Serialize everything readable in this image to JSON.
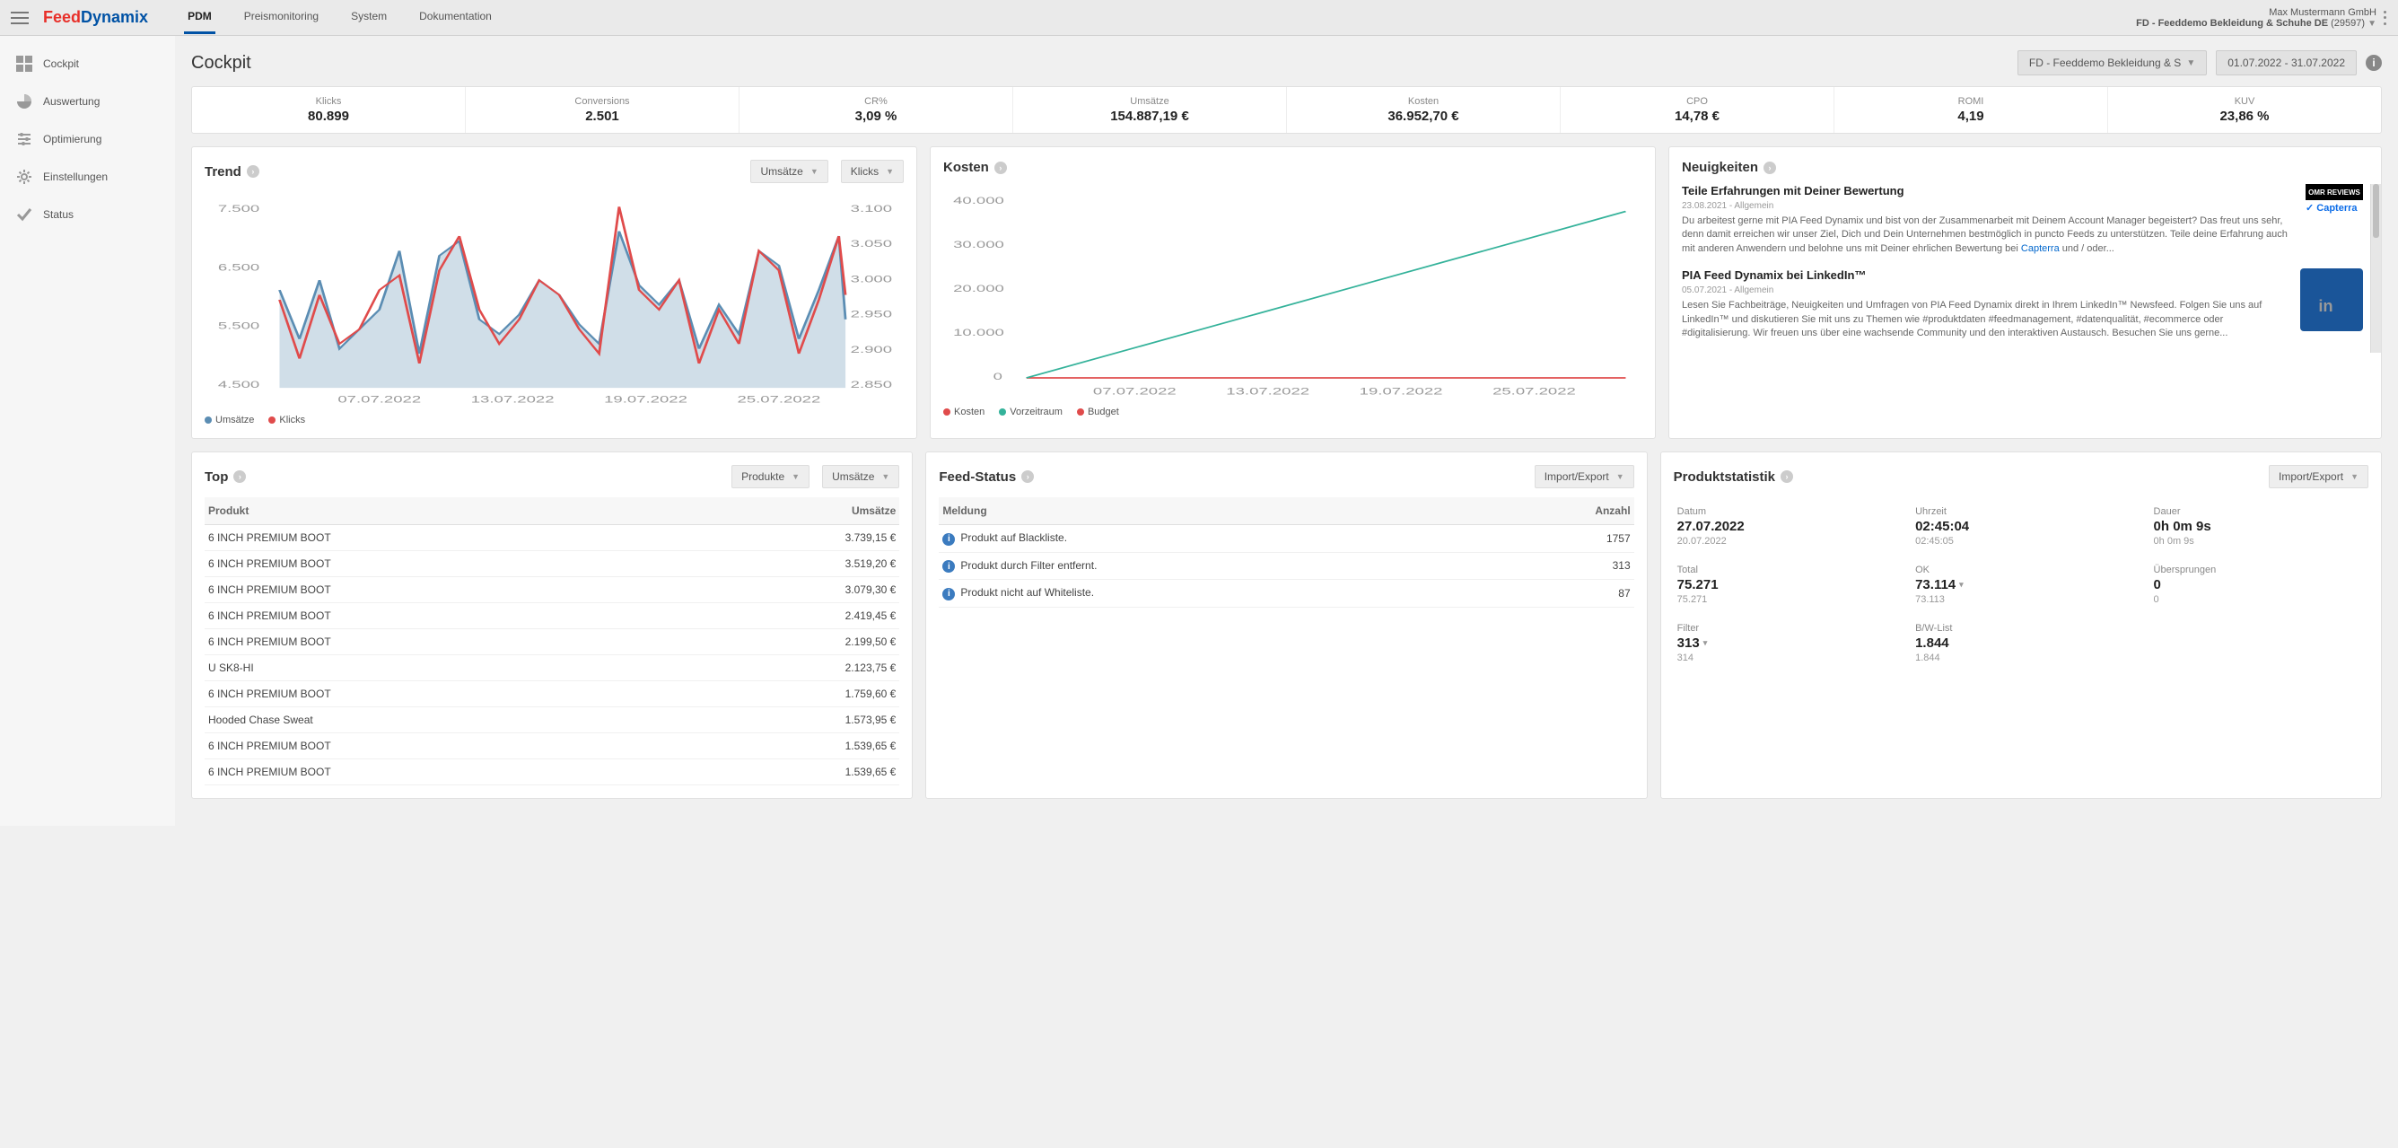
{
  "header": {
    "logo_part1": "Feed",
    "logo_part2": "Dynamix",
    "nav": [
      "PDM",
      "Preismonitoring",
      "System",
      "Dokumentation"
    ],
    "company": "Max Mustermann GmbH",
    "account": "FD - Feeddemo Bekleidung & Schuhe DE",
    "account_id": "(29597)"
  },
  "sidebar": {
    "items": [
      {
        "label": "Cockpit",
        "icon": "dashboard"
      },
      {
        "label": "Auswertung",
        "icon": "pie"
      },
      {
        "label": "Optimierung",
        "icon": "sliders"
      },
      {
        "label": "Einstellungen",
        "icon": "gear"
      },
      {
        "label": "Status",
        "icon": "check"
      }
    ]
  },
  "page": {
    "title": "Cockpit",
    "account_select": "FD - Feeddemo Bekleidung & S",
    "daterange": "01.07.2022 - 31.07.2022"
  },
  "kpis": [
    {
      "label": "Klicks",
      "value": "80.899"
    },
    {
      "label": "Conversions",
      "value": "2.501"
    },
    {
      "label": "CR%",
      "value": "3,09 %"
    },
    {
      "label": "Umsätze",
      "value": "154.887,19 €"
    },
    {
      "label": "Kosten",
      "value": "36.952,70 €"
    },
    {
      "label": "CPO",
      "value": "14,78 €"
    },
    {
      "label": "ROMI",
      "value": "4,19"
    },
    {
      "label": "KUV",
      "value": "23,86 %"
    }
  ],
  "trend": {
    "title": "Trend",
    "dd1": "Umsätze",
    "dd2": "Klicks",
    "legend": {
      "a": "Umsätze",
      "b": "Klicks"
    }
  },
  "kosten": {
    "title": "Kosten",
    "legend": {
      "a": "Kosten",
      "b": "Vorzeitraum",
      "c": "Budget"
    }
  },
  "news": {
    "title": "Neuigkeiten",
    "items": [
      {
        "title": "Teile Erfahrungen mit Deiner Bewertung",
        "meta": "23.08.2021 - Allgemein",
        "body": "Du arbeitest gerne mit PIA Feed Dynamix und bist von der Zusammenarbeit mit Deinem Account Manager begeistert? Das freut uns sehr, denn damit erreichen wir unser Ziel, Dich und Dein Unternehmen bestmöglich in puncto Feeds zu unterstützen. Teile deine Erfahrung auch mit anderen Anwendern und belohne uns mit Deiner ehrlichen Bewertung bei ",
        "link": "Capterra",
        "tail": " und / oder..."
      },
      {
        "title": "PIA Feed Dynamix bei LinkedIn™",
        "meta": "05.07.2021 - Allgemein",
        "body": "Lesen Sie Fachbeiträge, Neuigkeiten und Umfragen von PIA Feed Dynamix direkt in Ihrem LinkedIn™ Newsfeed. Folgen Sie uns auf LinkedIn™ und diskutieren Sie mit uns zu Themen wie #produktdaten #feedmanagement, #datenqualität, #ecommerce oder #digitalisierung. Wir freuen uns über eine wachsende Community und den interaktiven Austausch. Besuchen Sie uns gerne..."
      }
    ]
  },
  "top": {
    "title": "Top",
    "dd1": "Produkte",
    "dd2": "Umsätze",
    "col1": "Produkt",
    "col2": "Umsätze",
    "rows": [
      {
        "p": "6 INCH PREMIUM BOOT",
        "v": "3.739,15 €"
      },
      {
        "p": "6 INCH PREMIUM BOOT",
        "v": "3.519,20 €"
      },
      {
        "p": "6 INCH PREMIUM BOOT",
        "v": "3.079,30 €"
      },
      {
        "p": "6 INCH PREMIUM BOOT",
        "v": "2.419,45 €"
      },
      {
        "p": "6 INCH PREMIUM BOOT",
        "v": "2.199,50 €"
      },
      {
        "p": "U SK8-HI",
        "v": "2.123,75 €"
      },
      {
        "p": "6 INCH PREMIUM BOOT",
        "v": "1.759,60 €"
      },
      {
        "p": "Hooded Chase Sweat",
        "v": "1.573,95 €"
      },
      {
        "p": "6 INCH PREMIUM BOOT",
        "v": "1.539,65 €"
      },
      {
        "p": "6 INCH PREMIUM BOOT",
        "v": "1.539,65 €"
      }
    ]
  },
  "feed": {
    "title": "Feed-Status",
    "dd": "Import/Export",
    "col1": "Meldung",
    "col2": "Anzahl",
    "rows": [
      {
        "m": "Produkt auf Blackliste.",
        "n": "1757"
      },
      {
        "m": "Produkt durch Filter entfernt.",
        "n": "313"
      },
      {
        "m": "Produkt nicht auf Whiteliste.",
        "n": "87"
      }
    ]
  },
  "pstats": {
    "title": "Produktstatistik",
    "dd": "Import/Export",
    "blocks": [
      {
        "label": "Datum",
        "main": "27.07.2022",
        "sub": "20.07.2022"
      },
      {
        "label": "Uhrzeit",
        "main": "02:45:04",
        "sub": "02:45:05"
      },
      {
        "label": "Dauer",
        "main": "0h 0m 9s",
        "sub": "0h 0m 9s"
      },
      {
        "label": "Total",
        "main": "75.271",
        "sub": "75.271"
      },
      {
        "label": "OK",
        "main": "73.114",
        "sub": "73.113",
        "caret": true
      },
      {
        "label": "Übersprungen",
        "main": "0",
        "sub": "0"
      },
      {
        "label": "Filter",
        "main": "313",
        "sub": "314",
        "caret": true
      },
      {
        "label": "B/W-List",
        "main": "1.844",
        "sub": "1.844"
      }
    ]
  },
  "chart_data": [
    {
      "type": "line",
      "title": "Trend",
      "x_ticks": [
        "07.07.2022",
        "13.07.2022",
        "19.07.2022",
        "25.07.2022"
      ],
      "y_left_label": "Umsätze",
      "y_left_ticks": [
        4500,
        5500,
        6500,
        7500
      ],
      "y_right_label": "Klicks",
      "y_right_ticks": [
        2850,
        2900,
        2950,
        3000,
        3050,
        3100
      ],
      "series": [
        {
          "name": "Umsätze",
          "axis": "left",
          "color": "#5b8db3",
          "area": true,
          "values": [
            5900,
            5000,
            6100,
            4800,
            5200,
            5600,
            6800,
            4700,
            6700,
            7000,
            5400,
            5100,
            5500,
            6200,
            5800,
            5300,
            4900,
            7200,
            6000,
            5700,
            6100,
            4800,
            5700,
            5100,
            6700,
            6400,
            5100,
            5900,
            7100,
            5400
          ]
        },
        {
          "name": "Klicks",
          "axis": "right",
          "color": "#e04b4b",
          "values": [
            2960,
            2880,
            2970,
            2900,
            2920,
            2980,
            3000,
            2870,
            3010,
            3060,
            2940,
            2900,
            2930,
            2990,
            2970,
            2920,
            2890,
            3090,
            2980,
            2950,
            2990,
            2870,
            2940,
            2900,
            3040,
            3010,
            2890,
            2960,
            3060,
            2970
          ]
        }
      ]
    },
    {
      "type": "line",
      "title": "Kosten",
      "x_ticks": [
        "07.07.2022",
        "13.07.2022",
        "19.07.2022",
        "25.07.2022"
      ],
      "y_label": "",
      "y_ticks": [
        0,
        10000,
        20000,
        30000,
        40000
      ],
      "series": [
        {
          "name": "Kosten",
          "color": "#e04b4b",
          "values": [
            0,
            0,
            0,
            0,
            0,
            0,
            0,
            0,
            0,
            0,
            0,
            0,
            0,
            0,
            0,
            0,
            0,
            0,
            0,
            0,
            0,
            0,
            0,
            0,
            0,
            0,
            0,
            0,
            0,
            0
          ]
        },
        {
          "name": "Vorzeitraum",
          "color": "#34b29a",
          "values": [
            1200,
            2400,
            3600,
            4800,
            6000,
            7200,
            8400,
            9600,
            10800,
            12000,
            13200,
            14400,
            15600,
            16800,
            18000,
            19200,
            20400,
            21600,
            22800,
            24000,
            25200,
            26400,
            27600,
            28800,
            30000,
            31200,
            32400,
            33600,
            34800,
            36952
          ]
        },
        {
          "name": "Budget",
          "color": "#e04b4b",
          "values": [
            0,
            0,
            0,
            0,
            0,
            0,
            0,
            0,
            0,
            0,
            0,
            0,
            0,
            0,
            0,
            0,
            0,
            0,
            0,
            0,
            0,
            0,
            0,
            0,
            0,
            0,
            0,
            0,
            0,
            0
          ]
        }
      ]
    }
  ]
}
